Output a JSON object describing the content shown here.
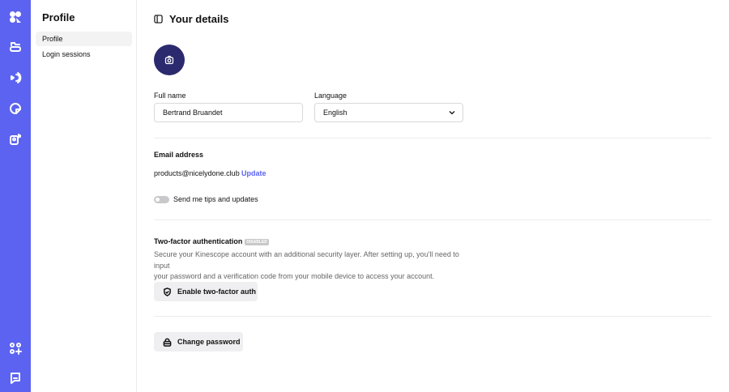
{
  "sidebar": {
    "icons": [
      "logo-icon",
      "folder-icon",
      "broadcast-icon",
      "analytics-icon",
      "user-speaker-icon",
      "apps-add-icon",
      "chat-icon"
    ]
  },
  "subnav": {
    "title": "Profile",
    "items": [
      {
        "label": "Profile",
        "active": true
      },
      {
        "label": "Login sessions",
        "active": false
      }
    ]
  },
  "main": {
    "title": "Your details",
    "full_name": {
      "label": "Full name",
      "value": "Bertrand Bruandet"
    },
    "language": {
      "label": "Language",
      "value": "English"
    },
    "email": {
      "heading": "Email address",
      "value": "products@nicelydone.club",
      "update_label": "Update"
    },
    "tips": {
      "label": "Send me tips and updates",
      "enabled": false
    },
    "two_factor": {
      "heading": "Two-factor authentication",
      "badge": "DISABLED",
      "description_line1": "Secure your Kinescope account with an additional security layer. After setting up, you'll need to input",
      "description_line2": "your password and a verification code from your mobile device to access your account.",
      "button": "Enable two-factor auth"
    },
    "password": {
      "button": "Change password"
    }
  },
  "colors": {
    "accent": "#5b63f0",
    "avatar": "#2b2a6e"
  }
}
